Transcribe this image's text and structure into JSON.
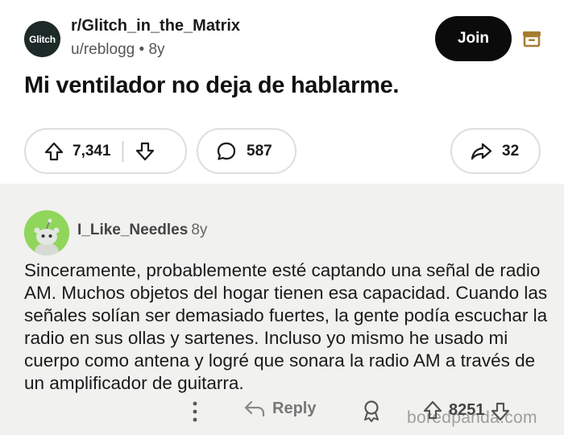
{
  "post": {
    "subreddit": "r/Glitch_in_the_Matrix",
    "subreddit_avatar_text": "Glitch",
    "author": "u/reblogg",
    "age": "8y",
    "join_label": "Join",
    "title": "Mi ventilador no deja de hablarme.",
    "upvotes": "7,341",
    "comments": "587",
    "shares": "32"
  },
  "comment": {
    "username": "I_Like_Needles",
    "age": "8y",
    "body": "Sinceramente, probablemente esté captando una señal de radio AM. Muchos objetos del hogar tienen esa capacidad. Cuando las señales solían ser demasiado fuertes, la gente podía escuchar la radio en sus ollas y sartenes. Incluso yo mismo he usado mi cuerpo como antena y logré que sonara la radio AM a través de un amplificador de guitarra.",
    "reply_label": "Reply",
    "votes": "8251"
  },
  "watermark": "boredpanda.com",
  "colors": {
    "join_bg": "#0b0b0b",
    "avatar_green": "#8fd65a",
    "archive_icon": "#a67c2e"
  }
}
